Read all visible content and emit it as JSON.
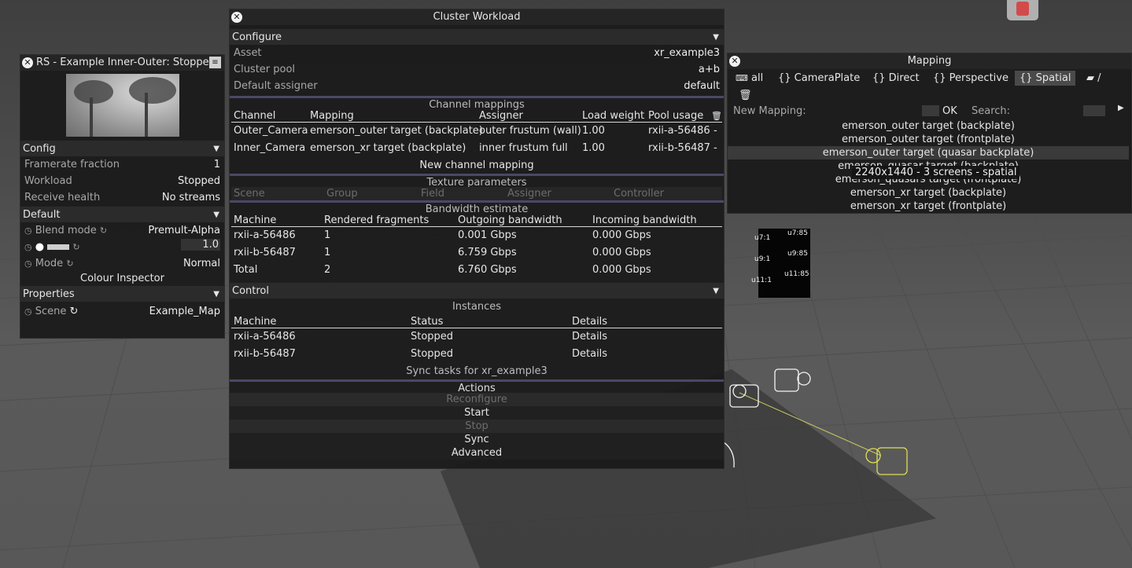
{
  "viewport": {
    "led_tags": [
      "u7:1",
      "u7:85",
      "u9:1",
      "u9:85",
      "u11:1",
      "u11:85"
    ]
  },
  "left_panel": {
    "title": "RS - Example Inner-Outer: Stopped",
    "config": {
      "header": "Config",
      "rows": [
        {
          "label": "Framerate fraction",
          "value": "1"
        },
        {
          "label": "Workload",
          "value": "Stopped"
        },
        {
          "label": "Receive health",
          "value": "No streams"
        }
      ]
    },
    "default": {
      "header": "Default",
      "blend_label": "Blend mode",
      "blend_value": "Premult-Alpha",
      "brightness_value": "1.0",
      "mode_label": "Mode",
      "mode_value": "Normal",
      "inspector_label": "Colour Inspector"
    },
    "properties": {
      "header": "Properties",
      "scene_label": "Scene",
      "scene_value": "Example_Map"
    }
  },
  "mapping_panel": {
    "title": "Mapping",
    "tabs": [
      "all",
      "{} CameraPlate",
      "{} Direct",
      "{} Perspective",
      "{} Spatial",
      "/"
    ],
    "new_mapping_label": "New Mapping:",
    "ok_label": "OK",
    "search_label": "Search:",
    "items": [
      "emerson_outer target (backplate)",
      "emerson_outer target (frontplate)",
      "emerson_outer target (quasar backplate)",
      "emerson_quasar target (backplate)",
      "emerson_quasars target (frontplate)",
      "emerson_xr target (backplate)",
      "emerson_xr target (frontplate)"
    ],
    "tooltip": "2240x1440 - 3 screens  - spatial"
  },
  "cluster_panel": {
    "title": "Cluster Workload",
    "configure": {
      "header": "Configure",
      "rows": [
        {
          "label": "Asset",
          "value": "xr_example3"
        },
        {
          "label": "Cluster pool",
          "value": "a+b"
        },
        {
          "label": "Default assigner",
          "value": "default"
        }
      ]
    },
    "channel_mappings": {
      "title": "Channel mappings",
      "columns": [
        "Channel",
        "Mapping",
        "Assigner",
        "Load weight",
        "Pool usage"
      ],
      "rows": [
        [
          "Outer_Camera",
          "emerson_outer target (backplate)",
          "outer frustum (wall)",
          "1.00",
          "rxii-a-56486",
          "-"
        ],
        [
          "Inner_Camera",
          "emerson_xr target (backplate)",
          "inner frustum full",
          "1.00",
          "rxii-b-56487",
          "-"
        ]
      ],
      "new_label": "New channel mapping"
    },
    "texture_parameters": {
      "title": "Texture parameters",
      "columns": [
        "Scene",
        "Group",
        "Field",
        "Assigner",
        "Controller"
      ]
    },
    "bandwidth": {
      "title": "Bandwidth estimate",
      "columns": [
        "Machine",
        "Rendered fragments",
        "Outgoing bandwidth",
        "Incoming bandwidth"
      ],
      "rows": [
        [
          "rxii-a-56486",
          "1",
          "0.001 Gbps",
          "0.000 Gbps"
        ],
        [
          "rxii-b-56487",
          "1",
          "6.759 Gbps",
          "0.000 Gbps"
        ],
        [
          "Total",
          "2",
          "6.760 Gbps",
          "0.000 Gbps"
        ]
      ]
    },
    "control": {
      "header": "Control",
      "instances_title": "Instances",
      "columns": [
        "Machine",
        "Status",
        "Details"
      ],
      "rows": [
        [
          "rxii-a-56486",
          "Stopped",
          "Details"
        ],
        [
          "rxii-b-56487",
          "Stopped",
          "Details"
        ]
      ],
      "sync_tasks": "Sync tasks for xr_example3"
    },
    "actions": {
      "title": "Actions",
      "reconfigure": "Reconfigure",
      "start": "Start",
      "stop": "Stop",
      "sync": "Sync",
      "advanced": "Advanced"
    }
  }
}
